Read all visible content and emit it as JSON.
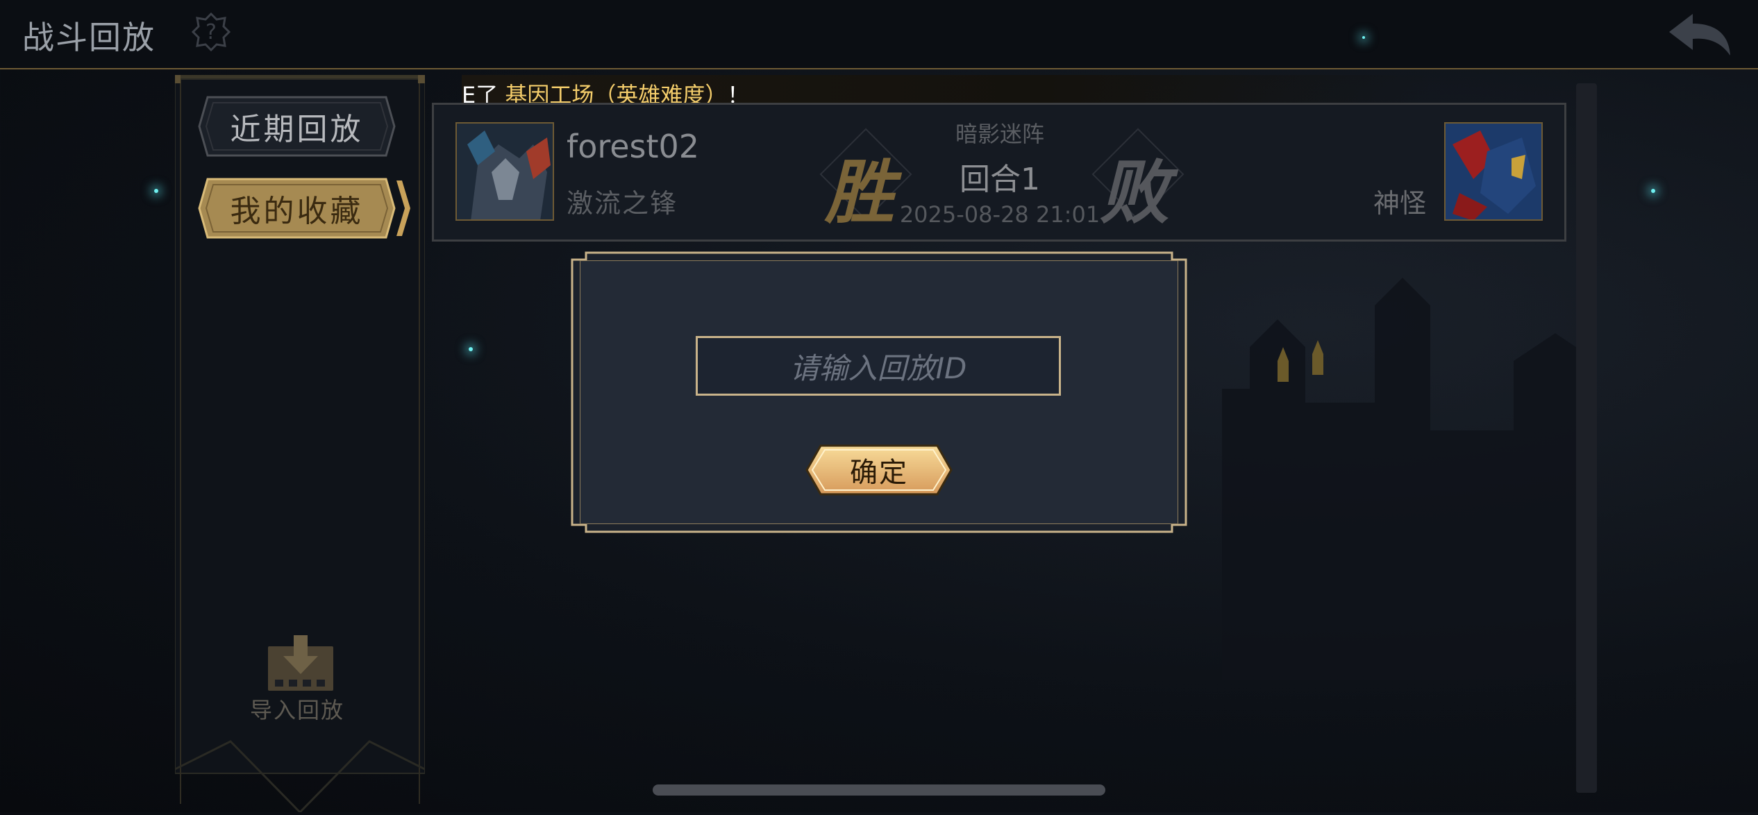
{
  "header": {
    "title": "战斗回放",
    "help_icon": "help-icon",
    "back_icon": "back-arrow-icon"
  },
  "sidebar": {
    "tabs": [
      {
        "label": "近期回放",
        "selected": false
      },
      {
        "label": "我的收藏",
        "selected": true
      }
    ],
    "import": {
      "label": "导入回放",
      "icon": "import-download-icon"
    }
  },
  "ticker": {
    "prefix": "E了 ",
    "highlight": "基因工场（英雄难度）",
    "suffix": "！"
  },
  "replay_card": {
    "player": {
      "name": "forest02",
      "title": "激流之锋"
    },
    "result_left": "胜",
    "result_right": "败",
    "map": "暗影迷阵",
    "round": "回合1",
    "datetime": "2025-08-28 21:01",
    "opponent": {
      "name": "神怪"
    }
  },
  "dialog": {
    "input_placeholder": "请输入回放ID",
    "input_value": "",
    "confirm_label": "确定"
  },
  "colors": {
    "accent_gold": "#c9a25a",
    "button_gold": "#f0c886",
    "ticker_highlight": "#f4cd6b",
    "panel_bg": "#232a36"
  }
}
